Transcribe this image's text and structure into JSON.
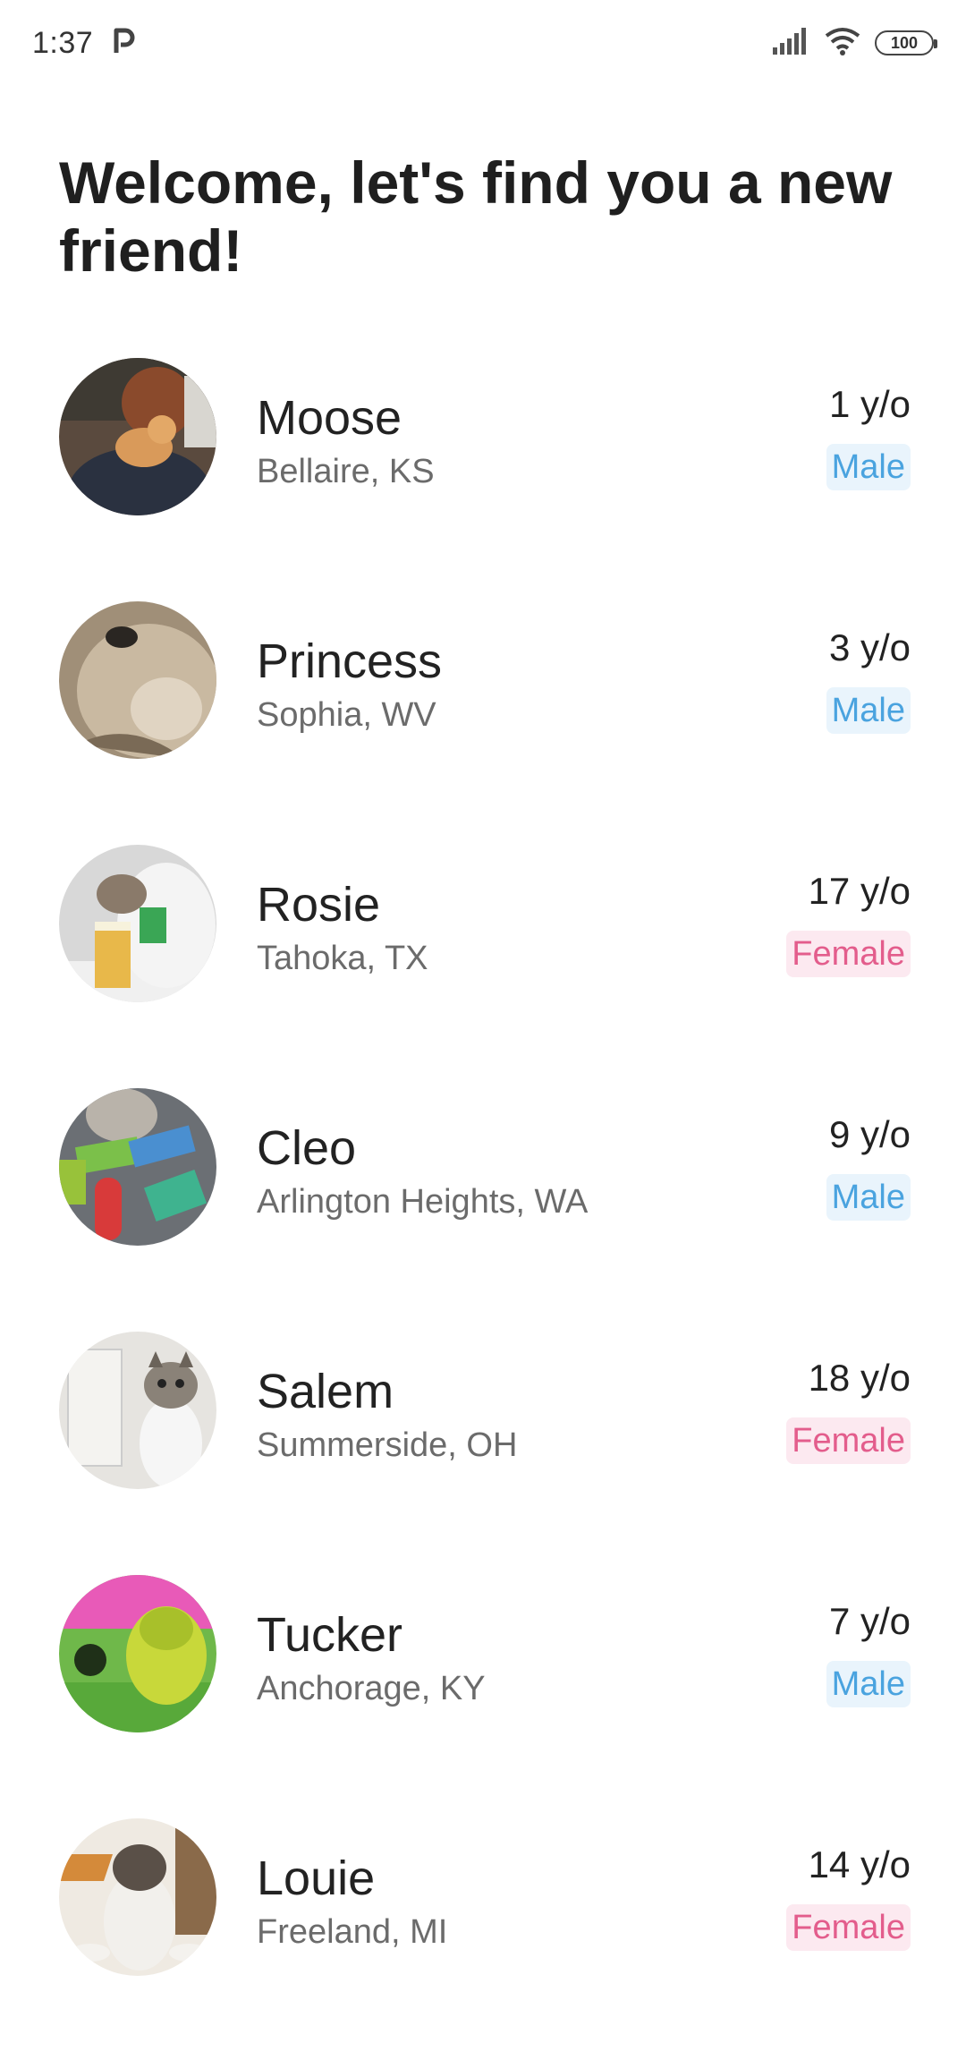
{
  "status": {
    "time": "1:37",
    "carrier_icon": "p-icon",
    "battery": "100"
  },
  "headline": "Welcome, let's find you a new friend!",
  "pets": [
    {
      "name": "Moose",
      "location": "Bellaire, KS",
      "age": "1 y/o",
      "gender": "Male"
    },
    {
      "name": "Princess",
      "location": "Sophia, WV",
      "age": "3 y/o",
      "gender": "Male"
    },
    {
      "name": "Rosie",
      "location": "Tahoka, TX",
      "age": "17 y/o",
      "gender": "Female"
    },
    {
      "name": "Cleo",
      "location": "Arlington Heights, WA",
      "age": "9 y/o",
      "gender": "Male"
    },
    {
      "name": "Salem",
      "location": "Summerside, OH",
      "age": "18 y/o",
      "gender": "Female"
    },
    {
      "name": "Tucker",
      "location": "Anchorage, KY",
      "age": "7 y/o",
      "gender": "Male"
    },
    {
      "name": "Louie",
      "location": "Freeland, MI",
      "age": "14 y/o",
      "gender": "Female"
    }
  ],
  "colors": {
    "male_text": "#4aa3df",
    "male_bg": "#e9f4fc",
    "female_text": "#e35d8c",
    "female_bg": "#fce9f0"
  }
}
